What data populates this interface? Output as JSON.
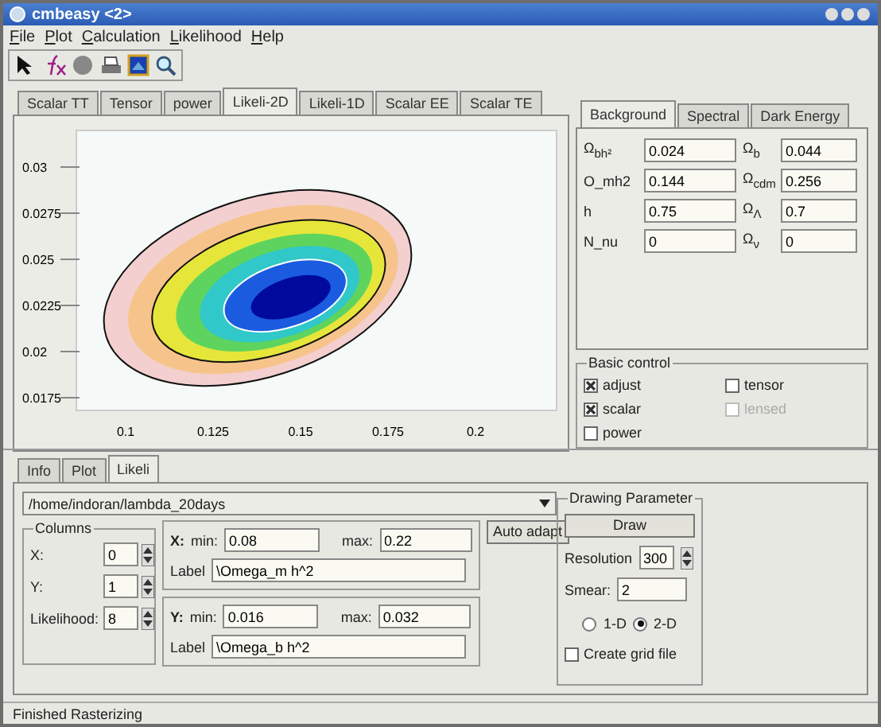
{
  "window": {
    "title": "cmbeasy <2>"
  },
  "menu": [
    {
      "label": "File"
    },
    {
      "label": "Plot"
    },
    {
      "label": "Calculation"
    },
    {
      "label": "Likelihood"
    },
    {
      "label": "Help"
    }
  ],
  "plot_tabs": [
    {
      "label": "Scalar TT",
      "selected": false
    },
    {
      "label": "Tensor",
      "selected": false
    },
    {
      "label": "power",
      "selected": false
    },
    {
      "label": "Likeli-2D",
      "selected": true
    },
    {
      "label": "Likeli-1D",
      "selected": false
    },
    {
      "label": "Scalar EE",
      "selected": false
    },
    {
      "label": "Scalar TE",
      "selected": false
    }
  ],
  "plot": {
    "x_ticks": [
      "0.1",
      "0.125",
      "0.15",
      "0.175",
      "0.2"
    ],
    "y_ticks": [
      "0.03",
      "0.0275",
      "0.025",
      "0.0225",
      "0.02",
      "0.0175"
    ]
  },
  "param_tabs": [
    {
      "label": "Background",
      "selected": true
    },
    {
      "label": "Spectral",
      "selected": false
    },
    {
      "label": "Dark Energy",
      "selected": false
    }
  ],
  "params": [
    {
      "label": "Ω$_{bh²}$",
      "value": "0.024"
    },
    {
      "label": "Ω$_{b}$",
      "value": "0.044"
    },
    {
      "label": "O_mh2",
      "value": "0.144"
    },
    {
      "label": "Ω$_{cdm}$",
      "value": "0.256"
    },
    {
      "label": "h",
      "value": "0.75"
    },
    {
      "label": "Ω$_{Λ}$",
      "value": "0.7"
    },
    {
      "label": "N_nu",
      "value": "0"
    },
    {
      "label": "Ω$_{ν}$",
      "value": "0"
    }
  ],
  "basic_control": {
    "title": "Basic control",
    "options": [
      {
        "label": "adjust",
        "checked": true,
        "disabled": false
      },
      {
        "label": "tensor",
        "checked": false,
        "disabled": false
      },
      {
        "label": "scalar",
        "checked": true,
        "disabled": false
      },
      {
        "label": "lensed",
        "checked": false,
        "disabled": true
      },
      {
        "label": "power",
        "checked": false,
        "disabled": false
      }
    ]
  },
  "bottom_tabs": [
    {
      "label": "Info",
      "selected": false
    },
    {
      "label": "Plot",
      "selected": false
    },
    {
      "label": "Likeli",
      "selected": true
    }
  ],
  "likeli": {
    "file": "/home/indoran/lambda_20days",
    "columns": {
      "title": "Columns",
      "rows": [
        {
          "label": "X:",
          "value": "0"
        },
        {
          "label": "Y:",
          "value": "1"
        },
        {
          "label": "Likelihood:",
          "value": "8"
        }
      ]
    },
    "axes": [
      {
        "axis": "X:",
        "min_label": "min:",
        "min": "0.08",
        "max_label": "max:",
        "max": "0.22",
        "label_label": "Label",
        "label": "\\Omega_m h^2"
      },
      {
        "axis": "Y:",
        "min_label": "min:",
        "min": "0.016",
        "max_label": "max:",
        "max": "0.032",
        "label_label": "Label",
        "label": "\\Omega_b h^2"
      }
    ],
    "auto_adapt": "Auto adapt",
    "drawing": {
      "title": "Drawing Parameter",
      "draw": "Draw",
      "resolution_label": "Resolution",
      "resolution": "300",
      "smear_label": "Smear:",
      "smear": "2",
      "radios": [
        {
          "label": "1-D",
          "selected": false
        },
        {
          "label": "2-D",
          "selected": true
        }
      ],
      "grid": {
        "label": "Create grid file",
        "checked": false
      }
    }
  },
  "status_bar": "Finished Rasterizing"
}
